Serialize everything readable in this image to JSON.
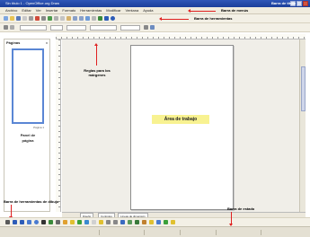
{
  "window": {
    "title": "Sin título 1 - OpenOffice.org Draw",
    "callout_title_bar": "Barra de título"
  },
  "menubar": {
    "items": [
      "Archivo",
      "Editar",
      "Ver",
      "Insertar",
      "Formato",
      "Herramientas",
      "Modificar",
      "Ventana",
      "Ayuda"
    ],
    "callout": "Barra de menús"
  },
  "toolbar": {
    "callout": "Barra de herramientas",
    "font_name": "Arial",
    "font_size": "18"
  },
  "rulers": {
    "callout_line1": "Reglas para los",
    "callout_line2": "márgenes"
  },
  "pages_panel": {
    "title": "Páginas",
    "close": "x",
    "thumb_label": "Página 1",
    "label_line1": "Panel de",
    "label_line2": "página"
  },
  "workspace": {
    "label": "Área de trabajo"
  },
  "tabs": [
    "Diseño",
    "Controles",
    "Líneas de dimensión"
  ],
  "drawbar": {
    "callout": "Barra de herramientas de dibujo"
  },
  "statusbar": {
    "callout": "Barra de estado"
  },
  "colors": {
    "titlebar": "#1b3e9a",
    "arrow": "#e02020",
    "work_label_bg": "#f8f291",
    "thumb_border": "#5a86d4"
  }
}
